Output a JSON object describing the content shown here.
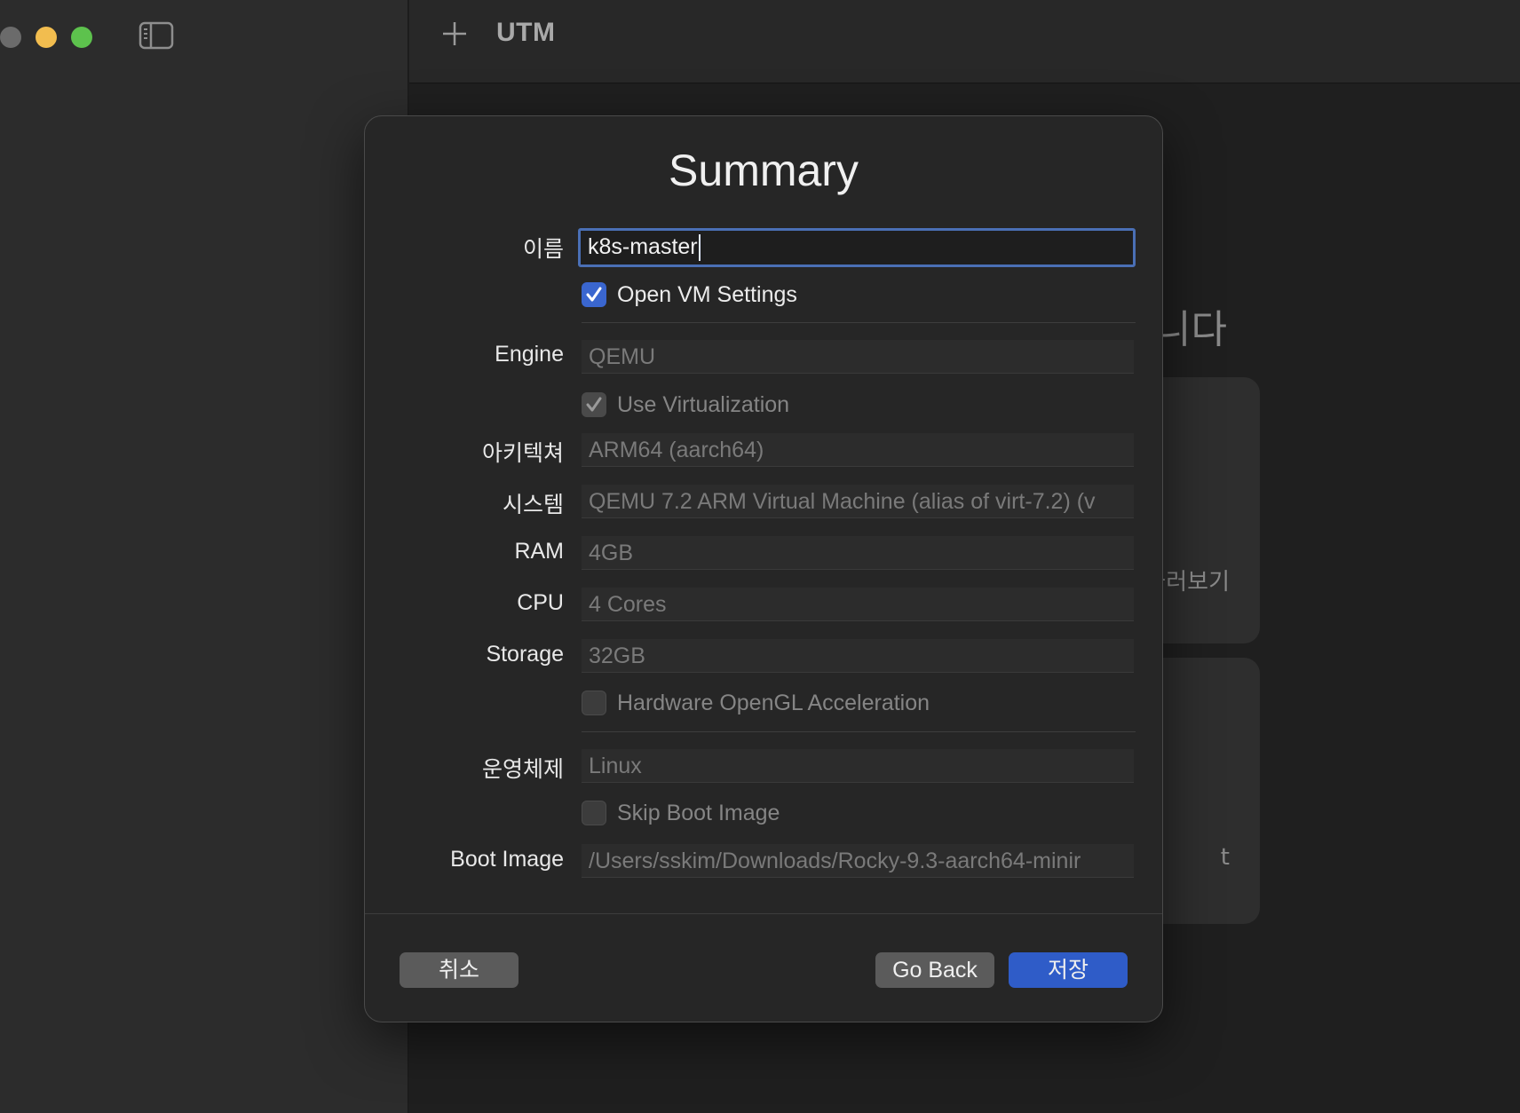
{
  "window": {
    "app_title": "UTM",
    "colors": {
      "close": "#6b6b6b",
      "minimize": "#f2bd4f",
      "maximize": "#5dc24d",
      "accent": "#2f5cc8"
    }
  },
  "background": {
    "heading_fragment": "니다",
    "card1_label_fragment": "둘러보기",
    "card2_label_fragment": "t"
  },
  "dialog": {
    "title": "Summary",
    "name_label": "이름",
    "name_value": "k8s-master",
    "open_vm_settings": {
      "label": "Open VM Settings",
      "checked": true
    },
    "engine": {
      "label": "Engine",
      "value": "QEMU"
    },
    "use_virtualization": {
      "label": "Use Virtualization",
      "checked": true
    },
    "architecture": {
      "label": "아키텍쳐",
      "value": "ARM64 (aarch64)"
    },
    "system": {
      "label": "시스템",
      "value": "QEMU 7.2 ARM Virtual Machine (alias of virt-7.2) (v"
    },
    "ram": {
      "label": "RAM",
      "value": "4GB"
    },
    "cpu": {
      "label": "CPU",
      "value": "4 Cores"
    },
    "storage": {
      "label": "Storage",
      "value": "32GB"
    },
    "hardware_opengl": {
      "label": "Hardware OpenGL Acceleration",
      "checked": false
    },
    "os": {
      "label": "운영체제",
      "value": "Linux"
    },
    "skip_boot_image": {
      "label": "Skip Boot Image",
      "checked": false
    },
    "boot_image": {
      "label": "Boot Image",
      "value": "/Users/sskim/Downloads/Rocky-9.3-aarch64-minir"
    },
    "buttons": {
      "cancel": "취소",
      "go_back": "Go Back",
      "save": "저장"
    }
  }
}
